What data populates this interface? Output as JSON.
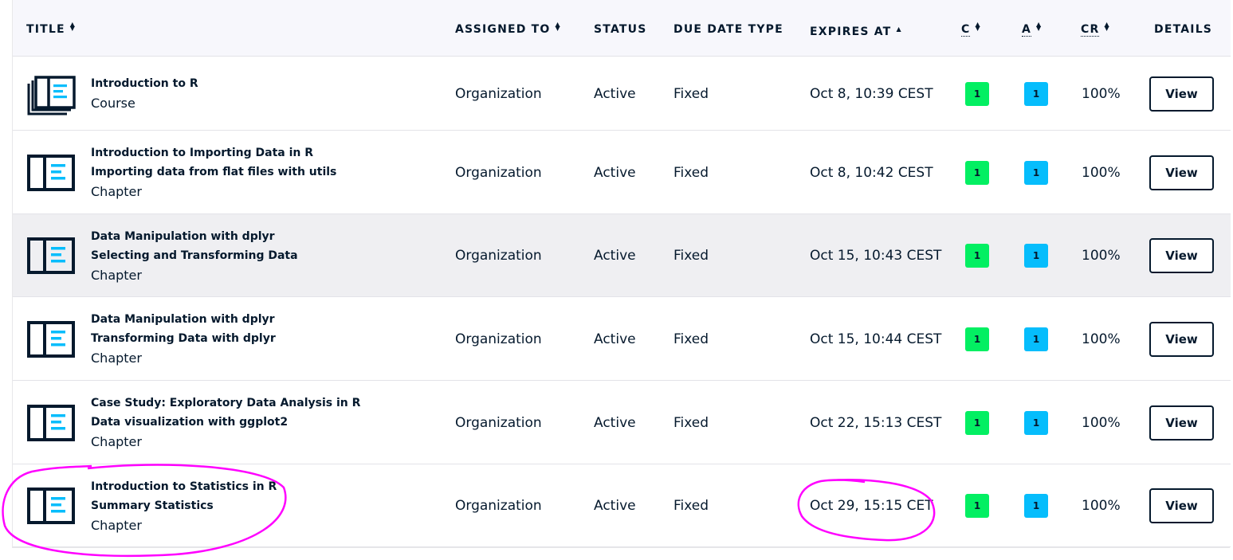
{
  "headers": {
    "title": "TITLE",
    "assigned_to": "ASSIGNED TO",
    "status": "STATUS",
    "due_date_type": "DUE DATE TYPE",
    "expires_at": "EXPIRES AT",
    "c": "C",
    "a": "A",
    "cr": "CR",
    "details": "DETAILS"
  },
  "icons": {
    "sort_both": "sort-icon",
    "sort_asc": "sort-ascending-icon",
    "content": "content-layout-icon",
    "course": "course-stack-icon"
  },
  "colors": {
    "completed_badge": "#03ef62",
    "attempted_badge": "#06bdfc",
    "annotation": "#ff00ff"
  },
  "rows": [
    {
      "lines": [
        "Introduction to R"
      ],
      "type": "Course",
      "assigned_to": "Organization",
      "status": "Active",
      "due_date_type": "Fixed",
      "expires_at": "Oct 8, 10:39 CEST",
      "c": "1",
      "a": "1",
      "cr": "100%",
      "details": "View"
    },
    {
      "lines": [
        "Introduction to Importing Data in R",
        "Importing data from flat files with utils"
      ],
      "type": "Chapter",
      "assigned_to": "Organization",
      "status": "Active",
      "due_date_type": "Fixed",
      "expires_at": "Oct 8, 10:42 CEST",
      "c": "1",
      "a": "1",
      "cr": "100%",
      "details": "View"
    },
    {
      "lines": [
        "Data Manipulation with dplyr",
        "Selecting and Transforming Data"
      ],
      "type": "Chapter",
      "assigned_to": "Organization",
      "status": "Active",
      "due_date_type": "Fixed",
      "expires_at": "Oct 15, 10:43 CEST",
      "c": "1",
      "a": "1",
      "cr": "100%",
      "details": "View"
    },
    {
      "lines": [
        "Data Manipulation with dplyr",
        "Transforming Data with dplyr"
      ],
      "type": "Chapter",
      "assigned_to": "Organization",
      "status": "Active",
      "due_date_type": "Fixed",
      "expires_at": "Oct 15, 10:44 CEST",
      "c": "1",
      "a": "1",
      "cr": "100%",
      "details": "View"
    },
    {
      "lines": [
        "Case Study: Exploratory Data Analysis in R",
        "Data visualization with ggplot2"
      ],
      "type": "Chapter",
      "assigned_to": "Organization",
      "status": "Active",
      "due_date_type": "Fixed",
      "expires_at": "Oct 22, 15:13 CEST",
      "c": "1",
      "a": "1",
      "cr": "100%",
      "details": "View"
    },
    {
      "lines": [
        "Introduction to Statistics in R",
        "Summary Statistics"
      ],
      "type": "Chapter",
      "assigned_to": "Organization",
      "status": "Active",
      "due_date_type": "Fixed",
      "expires_at": "Oct 29, 15:15 CET",
      "c": "1",
      "a": "1",
      "cr": "100%",
      "details": "View"
    }
  ]
}
